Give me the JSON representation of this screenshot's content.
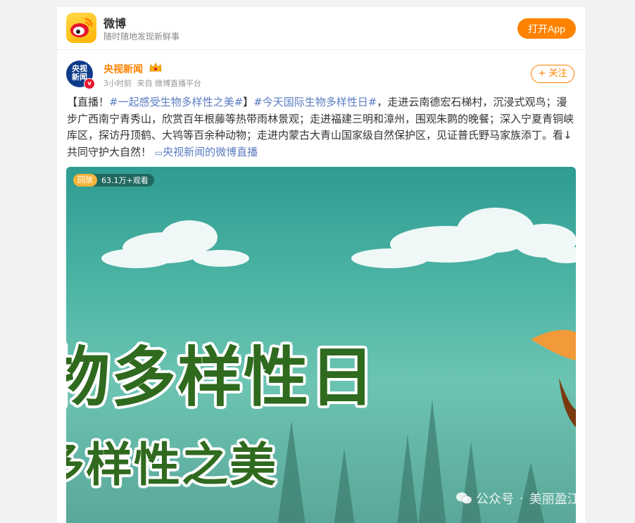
{
  "banner": {
    "app_name": "微博",
    "slogan": "随时随地发现新鲜事",
    "open_button": "打开App"
  },
  "post": {
    "avatar_text": "央视\n新闻",
    "author": "央视新闻",
    "time": "3小时前",
    "source": "来自 微博直播平台",
    "follow_label": "+ 关注",
    "text": {
      "prefix": "【直播！",
      "topic1": "#一起感受生物多样性之美#",
      "mid": "】",
      "topic2": "#今天国际生物多样性日#",
      "body": "，走进云南德宏石梯村，沉浸式观鸟；漫步广西南宁青秀山，欣赏百年根藤等热带雨林景观；走进福建三明和漳州，围观朱鹮的晚餐；深入宁夏青铜峡库区，探访丹顶鹤、大鸨等百余种动物；走进内蒙古大青山国家级自然保护区，见证普氏野马家族添丁。看↓共同守护大自然！",
      "live_link": "央视新闻的微博直播"
    }
  },
  "media": {
    "replay_badge": "回放",
    "views": "63.1万+观看",
    "headline1": "物多样性日",
    "headline2": "多样性之美"
  },
  "watermark": {
    "channel": "公众号",
    "name": "美丽盈江"
  },
  "colors": {
    "accent": "#ff8200",
    "link": "#5b7cc2",
    "headline": "#2f6a1e"
  }
}
